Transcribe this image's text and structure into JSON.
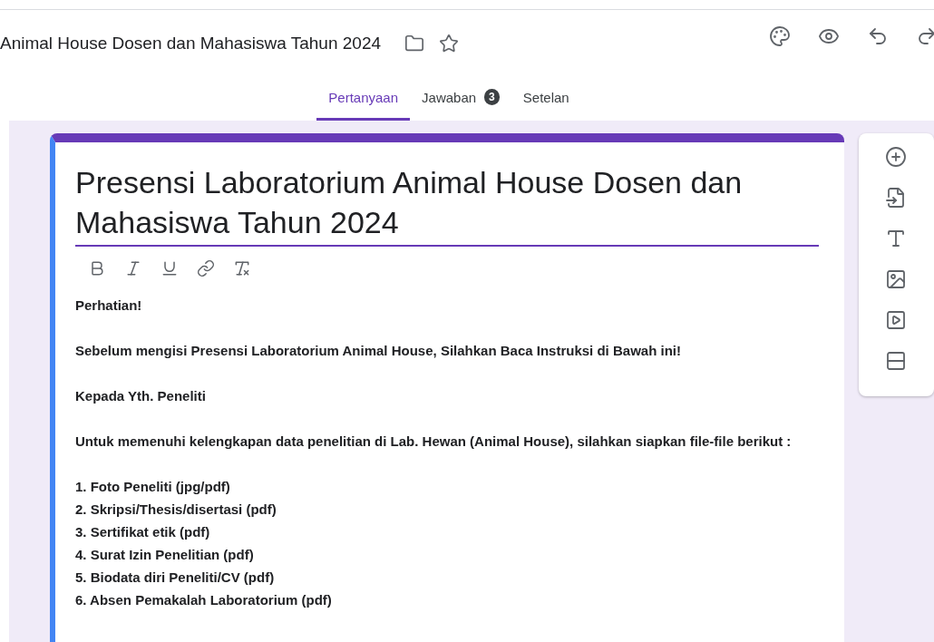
{
  "header": {
    "title": "Animal House Dosen dan Mahasiswa Tahun 2024"
  },
  "tabs": [
    {
      "label": "Pertanyaan",
      "selected": true
    },
    {
      "label": "Jawaban",
      "selected": false,
      "badge": "3"
    },
    {
      "label": "Setelan",
      "selected": false
    }
  ],
  "form": {
    "title": "Presensi Laboratorium Animal House Dosen dan Mahasiswa Tahun 2024",
    "description": [
      "Perhatian!",
      "Sebelum mengisi Presensi Laboratorium Animal House, Silahkan Baca Instruksi di Bawah ini!",
      "Kepada Yth. Peneliti",
      "Untuk memenuhi kelengkapan data penelitian di Lab. Hewan (Animal House), silahkan siapkan file-file berikut :"
    ],
    "list": [
      "1. Foto Peneliti (jpg/pdf)",
      "2. Skripsi/Thesis/disertasi (pdf)",
      "3. Sertifikat etik (pdf)",
      "4. Surat Izin Penelitian (pdf)",
      "5. Biodata diri Peneliti/CV (pdf)",
      "6. Absen Pemakalah Laboratorium (pdf)"
    ]
  }
}
